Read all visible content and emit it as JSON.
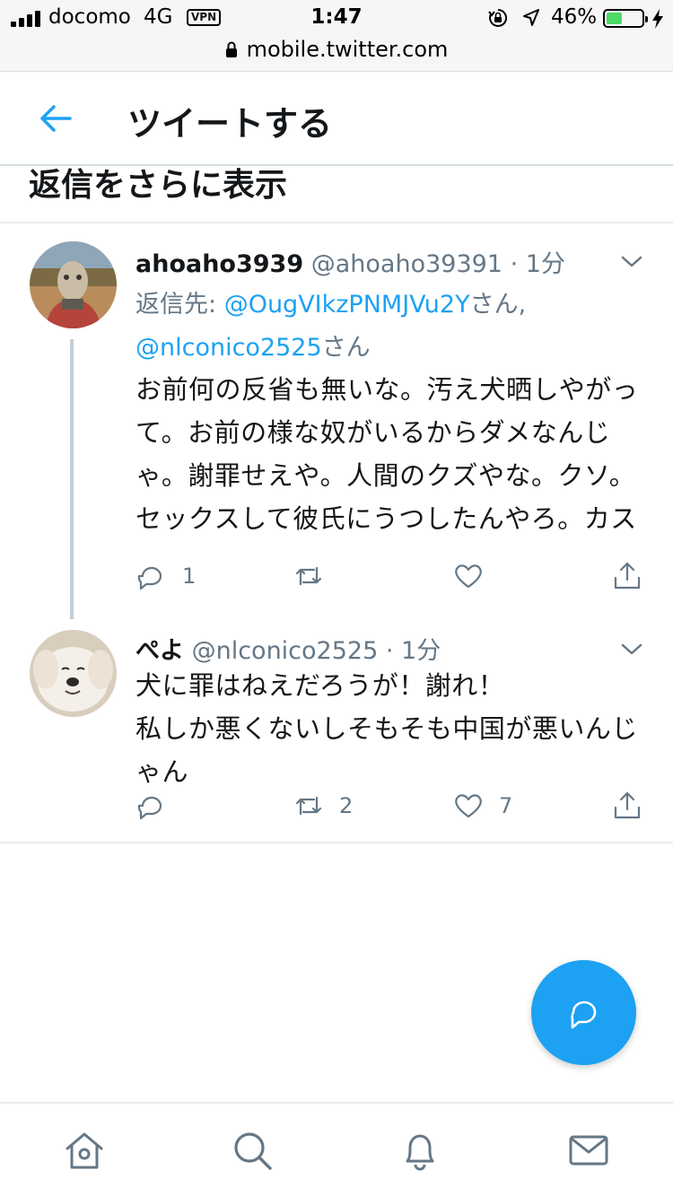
{
  "status_bar": {
    "carrier": "docomo",
    "network": "4G",
    "vpn": "VPN",
    "time": "1:47",
    "battery_percent": "46%",
    "battery_level": 0.46
  },
  "url_bar": {
    "url": "mobile.twitter.com"
  },
  "header": {
    "title": "ツイートする"
  },
  "show_more": {
    "label": "返信をさらに表示"
  },
  "tweets": [
    {
      "name": "ahoaho3939",
      "handle": "@ahoaho39391",
      "sep": "·",
      "time": "1分",
      "reply_prefix": "返信先: ",
      "reply_mention_1": "@OugVIkzPNMJVu2Y",
      "reply_suffix_1": "さん,",
      "reply_mention_2": "@nlconico2525",
      "reply_suffix_2": "さん",
      "text": "お前何の反省も無いな。汚え犬晒しやがって。お前の様な奴がいるからダメなんじゃ。謝罪せえや。人間のクズやな。クソ。セックスして彼氏にうつしたんやろ。カス",
      "reply_count": "1",
      "retweet_count": "",
      "like_count": ""
    },
    {
      "name": "ぺよ",
      "handle": "@nlconico2525",
      "sep": "·",
      "time": "1分",
      "text_line1": "犬に罪はねえだろうが！謝れ！",
      "text_line2": "私しか悪くないしそもそも中国が悪いんじゃん",
      "reply_count": "",
      "retweet_count": "2",
      "like_count": "7"
    }
  ],
  "icons": {
    "back": "arrow-left-icon",
    "caret": "chevron-down-icon",
    "reply": "reply-bubble-icon",
    "retweet": "retweet-icon",
    "like": "heart-icon",
    "share": "share-icon",
    "compose": "compose-reply-icon",
    "home": "home-icon",
    "search": "search-icon",
    "notifications": "bell-icon",
    "messages": "envelope-icon"
  },
  "colors": {
    "accent": "#1da1f2",
    "text_primary": "#14171a",
    "text_secondary": "#657786",
    "thread_line": "#c4cfd6",
    "icon_gray": "#657786"
  }
}
